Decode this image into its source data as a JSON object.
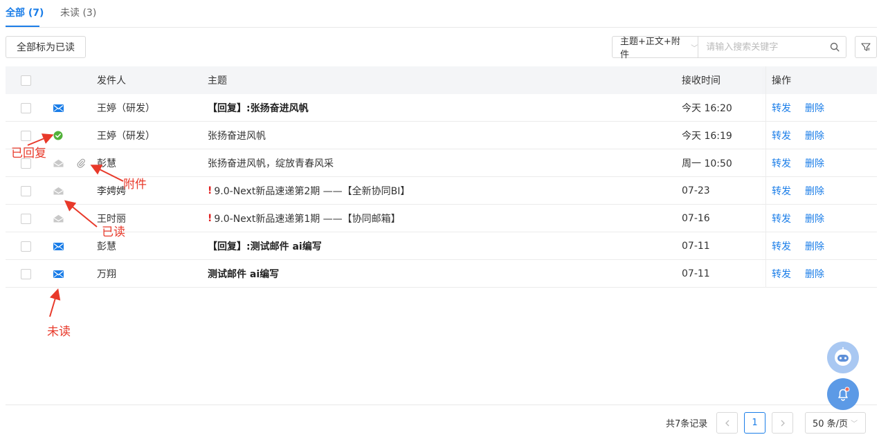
{
  "tabs": [
    {
      "label": "全部 (7)",
      "active": true
    },
    {
      "label": "未读 (3)",
      "active": false
    }
  ],
  "toolbar": {
    "mark_all_read": "全部标为已读",
    "search_scope": "主题+正文+附件",
    "search_placeholder": "请输入搜索关键字"
  },
  "columns": {
    "sender": "发件人",
    "subject": "主题",
    "received": "接收时间",
    "actions": "操作"
  },
  "rows": [
    {
      "status": "unread",
      "sender": "王婷（研发）",
      "urgent": "",
      "subject": "【回复】:张扬奋进风帆",
      "time": "今天 16:20",
      "forward": "转发",
      "delete": "删除",
      "attachment": false
    },
    {
      "status": "replied",
      "sender": "王婷（研发）",
      "urgent": "",
      "subject": "张扬奋进风帆",
      "time": "今天 16:19",
      "forward": "转发",
      "delete": "删除",
      "attachment": false
    },
    {
      "status": "read",
      "sender": "彭慧",
      "urgent": "",
      "subject": "张扬奋进风帆，绽放青春风采",
      "time": "周一 10:50",
      "forward": "转发",
      "delete": "删除",
      "attachment": true
    },
    {
      "status": "read",
      "sender": "李娉娉",
      "urgent": "!",
      "subject": "9.0-Next新品速递第2期 ——【全新协同BI】",
      "time": "07-23",
      "forward": "转发",
      "delete": "删除",
      "attachment": false
    },
    {
      "status": "read",
      "sender": "王时丽",
      "urgent": "!",
      "subject": "9.0-Next新品速递第1期 ——【协同邮箱】",
      "time": "07-16",
      "forward": "转发",
      "delete": "删除",
      "attachment": false
    },
    {
      "status": "unread",
      "sender": "彭慧",
      "urgent": "",
      "subject": "【回复】:测试邮件 ai编写",
      "time": "07-11",
      "forward": "转发",
      "delete": "删除",
      "attachment": false
    },
    {
      "status": "unread",
      "sender": "万翔",
      "urgent": "",
      "subject": "测试邮件 ai编写",
      "time": "07-11",
      "forward": "转发",
      "delete": "删除",
      "attachment": false
    }
  ],
  "annotations": {
    "replied": "已回复",
    "attachment": "附件",
    "read": "已读",
    "unread": "未读"
  },
  "pagination": {
    "total": "共7条记录",
    "current_page": "1",
    "page_size": "50 条/页"
  },
  "colors": {
    "accent": "#1a7de8",
    "replied_green": "#52b13a",
    "annotation_red": "#e8392a"
  }
}
